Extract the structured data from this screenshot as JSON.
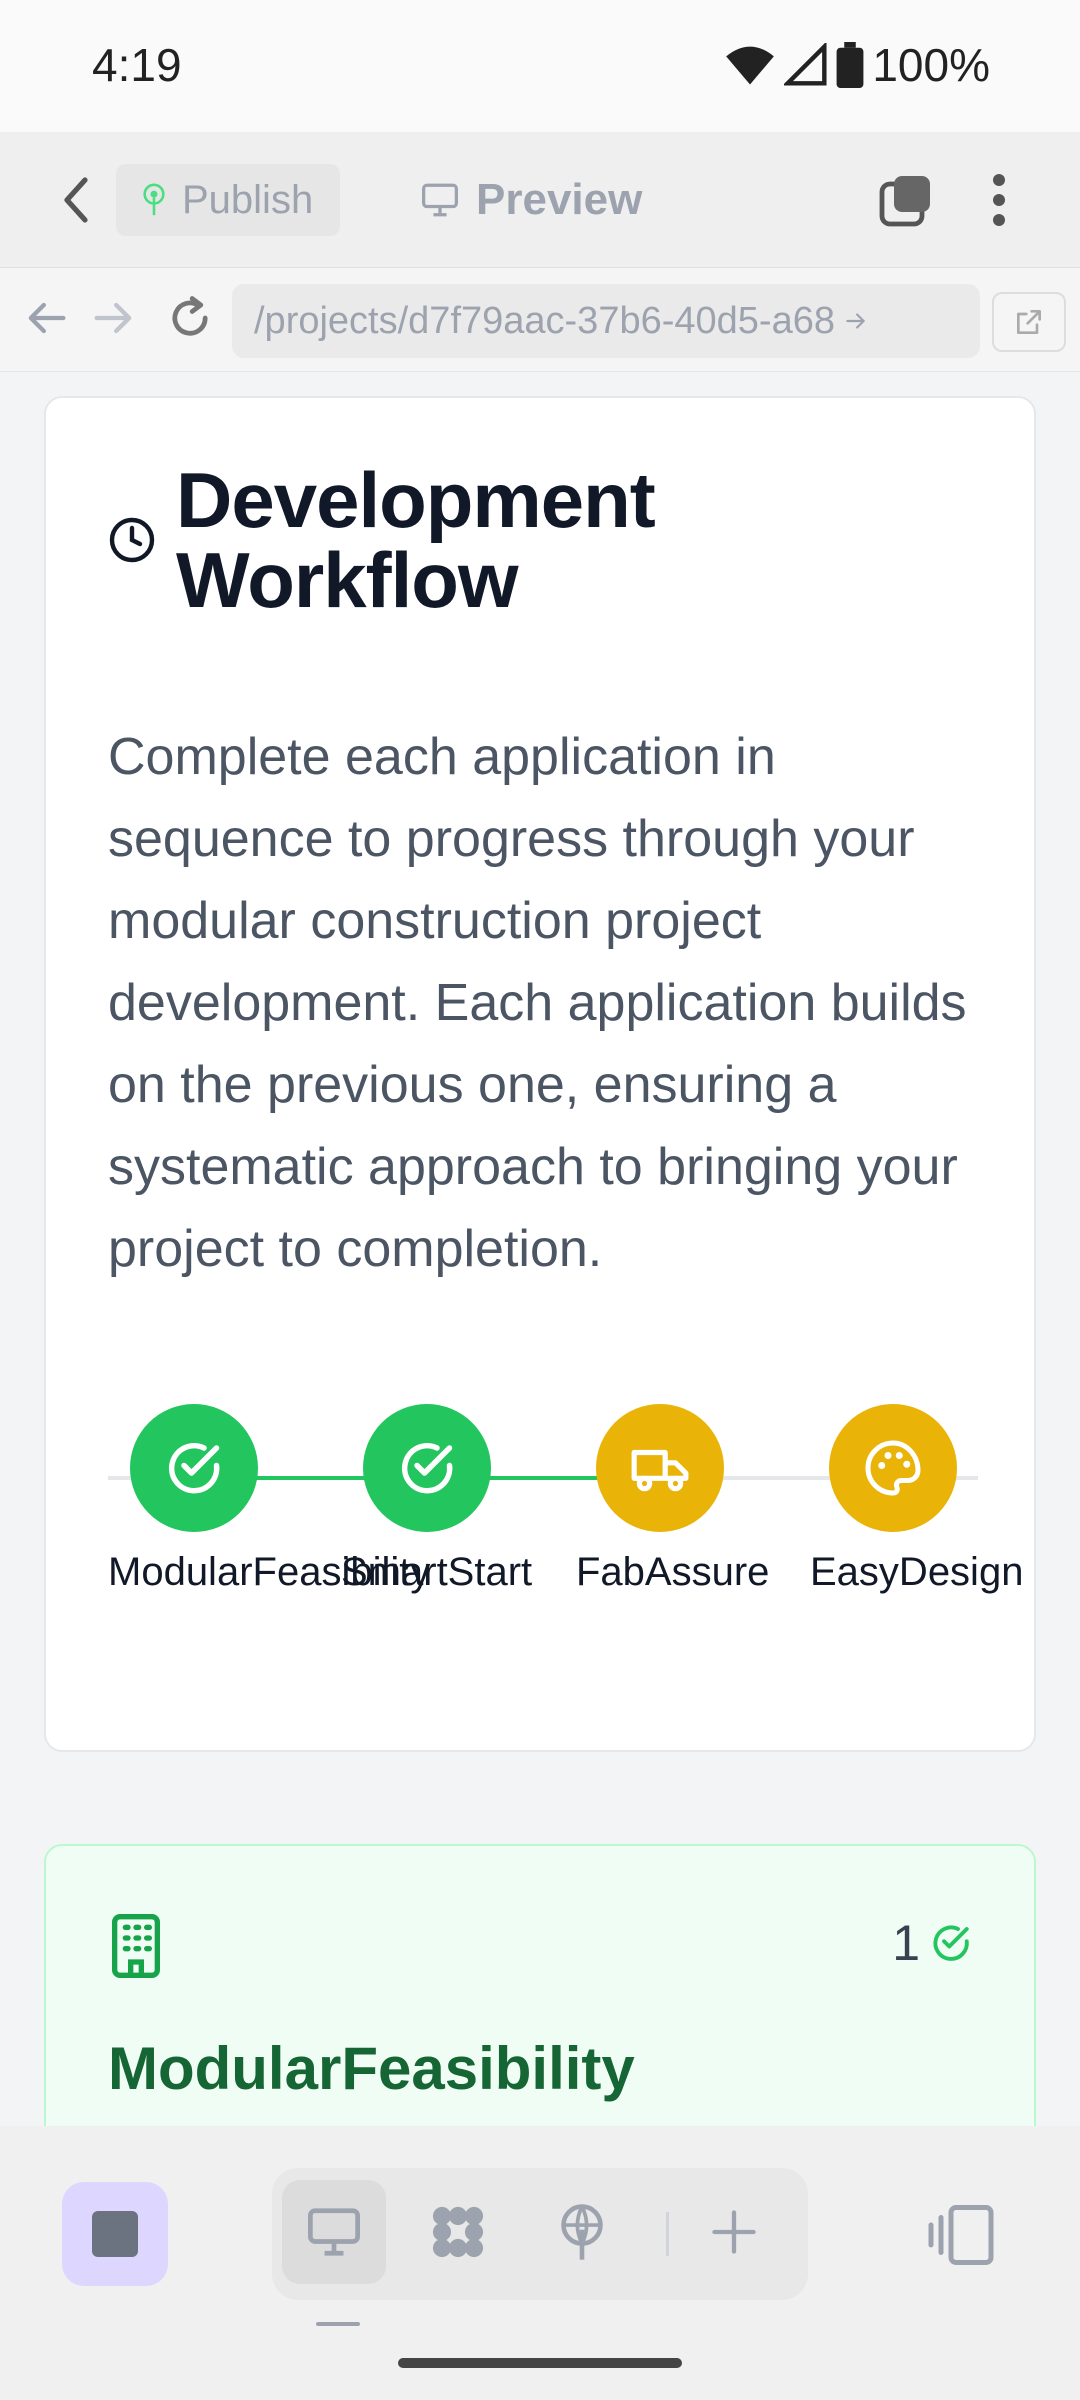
{
  "status": {
    "time": "4:19",
    "battery": "100%"
  },
  "toolbar": {
    "publish_label": "Publish",
    "preview_label": "Preview"
  },
  "browser": {
    "url": "/projects/d7f79aac-37b6-40d5-a68"
  },
  "workflow": {
    "title_line1": "Development",
    "title_line2": "Workflow",
    "description": "Complete each application in sequence to progress through your modular construction project development. Each application builds on the previous one, ensuring a systematic approach to bringing your project to completion.",
    "steps": [
      {
        "label": "ModularFeasibility",
        "status": "complete",
        "icon": "check-circle-icon"
      },
      {
        "label": "SmartStart",
        "status": "complete",
        "icon": "check-circle-icon"
      },
      {
        "label": "FabAssure",
        "status": "pending",
        "icon": "truck-icon"
      },
      {
        "label": "EasyDesign",
        "status": "pending",
        "icon": "palette-icon"
      }
    ]
  },
  "app_card": {
    "number": "1",
    "title": "ModularFeasibility",
    "icon": "building-icon"
  },
  "colors": {
    "complete": "#22c55e",
    "pending": "#eab308",
    "accent": "#ddd6fe"
  }
}
